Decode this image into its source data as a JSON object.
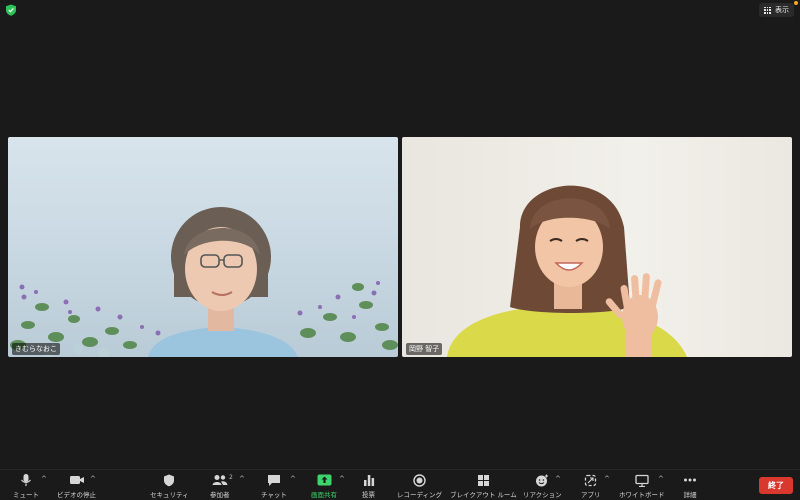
{
  "top": {
    "view_label": "表示"
  },
  "participants": [
    {
      "name": "きむらなおこ"
    },
    {
      "name": "岡野 智子"
    }
  ],
  "toolbar": {
    "mute": "ミュート",
    "video": "ビデオの停止",
    "security": "セキュリティ",
    "participants": "参加者",
    "participants_count": "2",
    "chat": "チャット",
    "share": "画面共有",
    "poll": "投票",
    "record": "レコーディング",
    "breakout": "ブレイクアウト ルーム",
    "reactions": "リアクション",
    "apps": "アプリ",
    "whiteboard": "ホワイトボード",
    "more": "詳細",
    "end": "終了"
  },
  "colors": {
    "share_green": "#3dd46b",
    "end_red": "#d9382e",
    "shield_green": "#2fc25b"
  }
}
